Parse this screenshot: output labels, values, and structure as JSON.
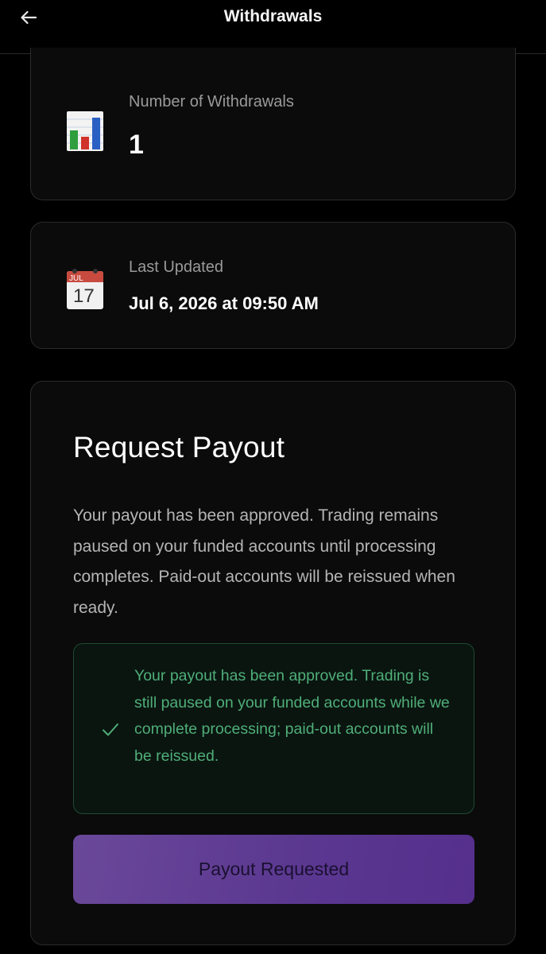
{
  "header": {
    "title": "Withdrawals",
    "back_icon": "arrow-left-icon"
  },
  "stats": {
    "withdrawals": {
      "label": "Number of Withdrawals",
      "value": "1",
      "icon": "bar-chart-icon"
    },
    "last_updated": {
      "label": "Last Updated",
      "value": "Jul 6, 2026 at 09:50 AM",
      "icon": "calendar-icon",
      "icon_month": "JUL",
      "icon_day": "17"
    }
  },
  "payout": {
    "title": "Request Payout",
    "description": "Your payout has been approved. Trading remains paused on your funded accounts until processing completes. Paid-out accounts will be reissued when ready.",
    "notice": {
      "icon": "check-icon",
      "text": "Your payout has been approved. Trading is still paused on your funded accounts while we complete processing; paid-out accounts will be reissued."
    },
    "button_label": "Payout Requested"
  },
  "colors": {
    "background": "#000000",
    "card": "#0b0b0b",
    "success": "#4fae78",
    "button": "#5a3790"
  }
}
